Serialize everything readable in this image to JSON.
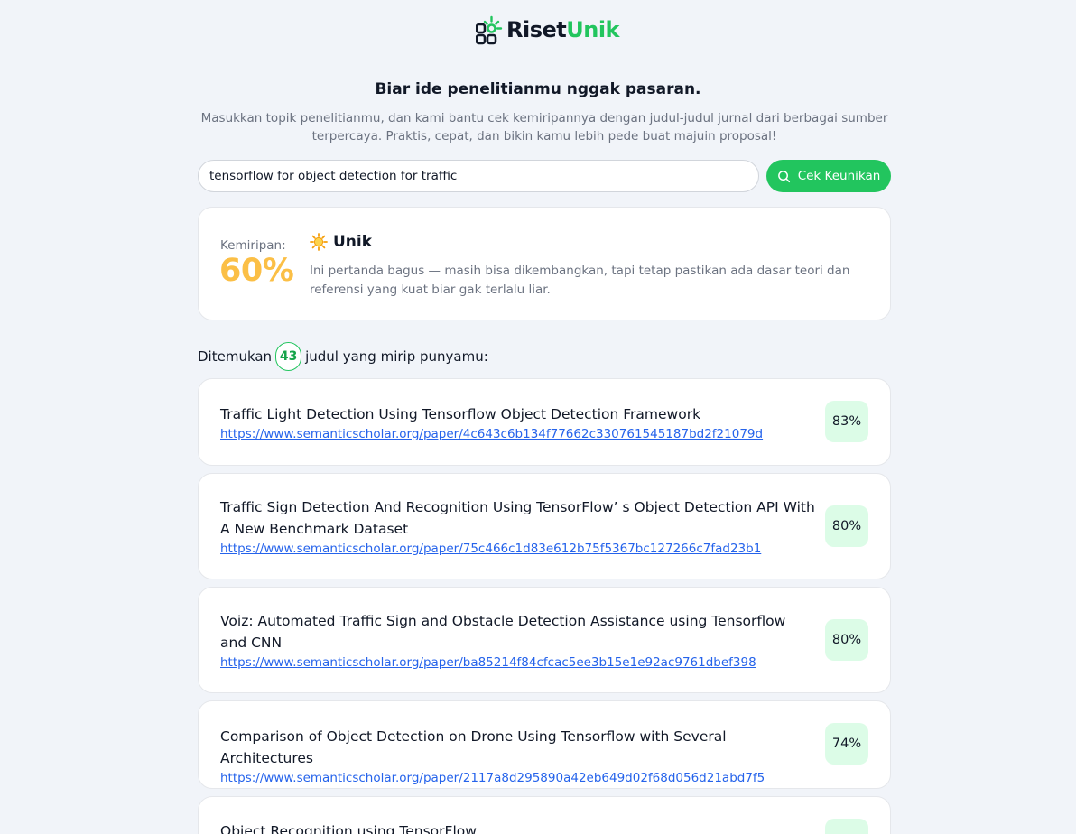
{
  "brand": {
    "part1": "Riset",
    "part2": "Unik",
    "color_green": "#22c55e"
  },
  "hero": {
    "title": "Biar ide penelitianmu nggak pasaran.",
    "subtitle": "Masukkan topik penelitianmu, dan kami bantu cek kemiripannya dengan judul-judul jurnal dari berbagai sumber terpercaya. Praktis, cepat, dan bikin kamu lebih pede buat majuin proposal!"
  },
  "search": {
    "value": "tensorflow for object detection for traffic",
    "button_label": "Cek Keunikan",
    "button_icon": "search-icon"
  },
  "result": {
    "similarity_label": "Kemiripan:",
    "similarity_value": "60%",
    "verdict_icon": "sun-emoji",
    "verdict": "Unik",
    "description": "Ini pertanda bagus — masih bisa dikembangkan, tapi tetap pastikan ada dasar teori dan referensi yang kuat biar gak terlalu liar.",
    "accent_color": "#fbbf46"
  },
  "found": {
    "prefix": "Ditemukan",
    "count": "43",
    "suffix": "judul yang mirip punyamu:"
  },
  "papers": [
    {
      "title": "Traffic Light Detection Using Tensorflow Object Detection Framework",
      "url": "https://www.semanticscholar.org/paper/4c643c6b134f77662c330761545187bd2f21079d",
      "score": "83%"
    },
    {
      "title": "Traffic Sign Detection And Recognition Using TensorFlow’ s Object Detection API With A New Benchmark Dataset",
      "url": "https://www.semanticscholar.org/paper/75c466c1d83e612b75f5367bc127266c7fad23b1",
      "score": "80%"
    },
    {
      "title": "Voiz: Automated Traffic Sign and Obstacle Detection Assistance using Tensorflow and CNN",
      "url": "https://www.semanticscholar.org/paper/ba85214f84cfcac5ee3b15e1e92ac9761dbef398",
      "score": "80%"
    },
    {
      "title": "Comparison of Object Detection on Drone Using Tensorflow with Several Architectures",
      "url": "https://www.semanticscholar.org/paper/2117a8d295890a42eb649d02f68d056d21abd7f5",
      "score": "74%"
    },
    {
      "title": "Object Recognition using TensorFlow",
      "url": "",
      "score": ""
    }
  ]
}
